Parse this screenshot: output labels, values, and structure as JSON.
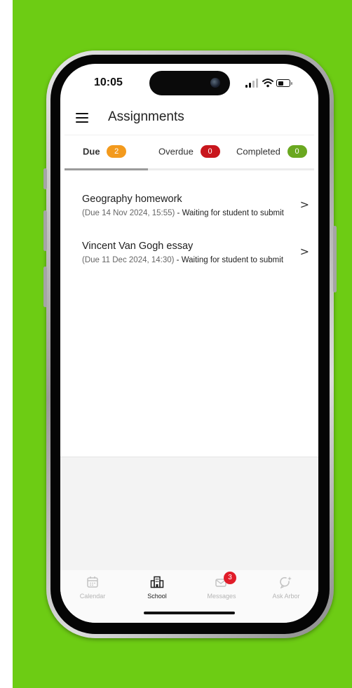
{
  "status_bar": {
    "time": "10:05"
  },
  "header": {
    "title": "Assignments",
    "menu_icon": "hamburger-menu-icon"
  },
  "tabs": [
    {
      "label": "Due",
      "count": "2",
      "color": "#f39a1d",
      "active": true
    },
    {
      "label": "Overdue",
      "count": "0",
      "color": "#c8161d",
      "active": false
    },
    {
      "label": "Completed",
      "count": "0",
      "color": "#6aa820",
      "active": false
    }
  ],
  "assignments": [
    {
      "title": "Geography homework",
      "due": "(Due 14 Nov 2024, 15:55)",
      "status": " - Waiting for student to submit",
      "chevron": ">"
    },
    {
      "title": "Vincent Van Gogh essay",
      "due": "(Due 11 Dec 2024, 14:30)",
      "status": " - Waiting for student to submit",
      "chevron": ">"
    }
  ],
  "bottom_nav": [
    {
      "label": "Calendar",
      "icon": "calendar-icon",
      "active": false
    },
    {
      "label": "School",
      "icon": "school-building-icon",
      "active": true
    },
    {
      "label": "Messages",
      "icon": "messages-icon",
      "active": false,
      "badge": "3"
    },
    {
      "label": "Ask Arbor",
      "icon": "ask-arbor-icon",
      "active": false
    }
  ],
  "colors": {
    "background": "#6dcc14",
    "message_badge": "#e11d2a"
  }
}
